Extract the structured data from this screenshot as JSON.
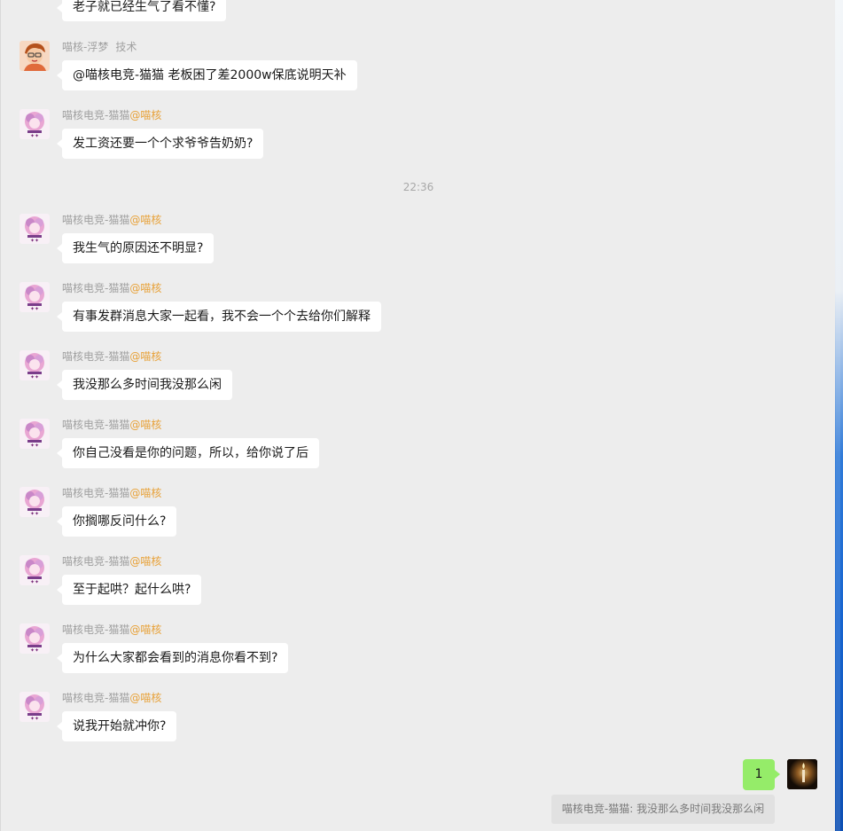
{
  "chat": {
    "timestamp": "22:36",
    "top_partial_text": "老子就已经生气了看不懂?",
    "messages": [
      {
        "sender": "喵核-浮梦",
        "tag": "技术",
        "mention": "",
        "text": "@喵核电竞-猫猫 老板困了差2000w保底说明天补",
        "avatar": "cartoon-avatar"
      },
      {
        "sender": "喵核电竞-猫猫",
        "tag": "",
        "mention": "@喵核",
        "text": "发工资还要一个个求爷爷告奶奶?",
        "avatar": "anime-avatar"
      },
      {
        "sender": "喵核电竞-猫猫",
        "tag": "",
        "mention": "@喵核",
        "text": "我生气的原因还不明显?",
        "avatar": "anime-avatar"
      },
      {
        "sender": "喵核电竞-猫猫",
        "tag": "",
        "mention": "@喵核",
        "text": "有事发群消息大家一起看，我不会一个个去给你们解释",
        "avatar": "anime-avatar"
      },
      {
        "sender": "喵核电竞-猫猫",
        "tag": "",
        "mention": "@喵核",
        "text": "我没那么多时间我没那么闲",
        "avatar": "anime-avatar"
      },
      {
        "sender": "喵核电竞-猫猫",
        "tag": "",
        "mention": "@喵核",
        "text": "你自己没看是你的问题，所以，给你说了后",
        "avatar": "anime-avatar"
      },
      {
        "sender": "喵核电竞-猫猫",
        "tag": "",
        "mention": "@喵核",
        "text": "你搁哪反问什么?",
        "avatar": "anime-avatar"
      },
      {
        "sender": "喵核电竞-猫猫",
        "tag": "",
        "mention": "@喵核",
        "text": "至于起哄？起什么哄?",
        "avatar": "anime-avatar"
      },
      {
        "sender": "喵核电竞-猫猫",
        "tag": "",
        "mention": "@喵核",
        "text": "为什么大家都会看到的消息你看不到?",
        "avatar": "anime-avatar"
      },
      {
        "sender": "喵核电竞-猫猫",
        "tag": "",
        "mention": "@喵核",
        "text": "说我开始就冲你?",
        "avatar": "anime-avatar"
      }
    ],
    "my_message": {
      "text": "1",
      "quote": "喵核电竞-猫猫: 我没那么多时间我没那么闲"
    }
  },
  "colors": {
    "background": "#ededed",
    "bubble": "#ffffff",
    "my_bubble": "#95ec69",
    "mention": "#e8a23a",
    "meta_text": "#a0a0a0"
  }
}
